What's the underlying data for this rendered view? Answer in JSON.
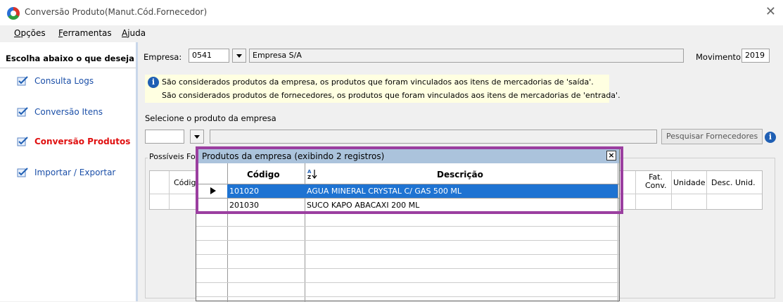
{
  "window": {
    "title": "Conversão Produto(Manut.Cód.Fornecedor)",
    "close": "✕"
  },
  "menu": [
    {
      "label_pre": "",
      "accel": "O",
      "label_post": "pções"
    },
    {
      "label_pre": "",
      "accel": "F",
      "label_post": "erramentas"
    },
    {
      "label_pre": "",
      "accel": "A",
      "label_post": "juda"
    }
  ],
  "sidebar": {
    "header": "Escolha abaixo o que deseja",
    "items": [
      {
        "label": "Consulta Logs"
      },
      {
        "label": "Conversão Itens"
      },
      {
        "label": "Conversão Produtos"
      },
      {
        "label": "Importar / Exportar"
      }
    ]
  },
  "form": {
    "empresa_label": "Empresa:",
    "empresa_code": "0541",
    "empresa_name": "Empresa S/A",
    "movimento_label": "Movimento:",
    "movimento_value": "2019",
    "info_line1": "São considerados produtos da empresa, os produtos que foram vinculados aos itens de mercadorias de 'saída'.",
    "info_line2": "São considerados produtos de fornecedores, os produtos que foram vinculados aos itens de mercadorias de 'entrada'.",
    "select_label": "Selecione o produto da empresa",
    "search_button": "Pesquisar Fornecedores",
    "group_title": "Possíveis Fo",
    "bg_columns": {
      "codigo": "Códig",
      "fat_conv": "Fat.\nConv.",
      "unidade": "Unidade",
      "desc_unid": "Desc. Unid."
    }
  },
  "popup": {
    "title": "Produtos da empresa (exibindo 2 registros)",
    "col_codigo": "Código",
    "col_descricao": "Descrição",
    "sort_icon": "AZ-sort-icon",
    "rows": [
      {
        "codigo": "101020",
        "descricao": "AGUA MINERAL CRYSTAL C/ GAS 500 ML"
      },
      {
        "codigo": "201030",
        "descricao": "SUCO KAPO ABACAXI 200 ML"
      }
    ]
  },
  "colors": {
    "highlight": "#9b3fa0",
    "selection": "#1e73d2",
    "active_item": "#e01010",
    "link": "#1b4fa8"
  }
}
